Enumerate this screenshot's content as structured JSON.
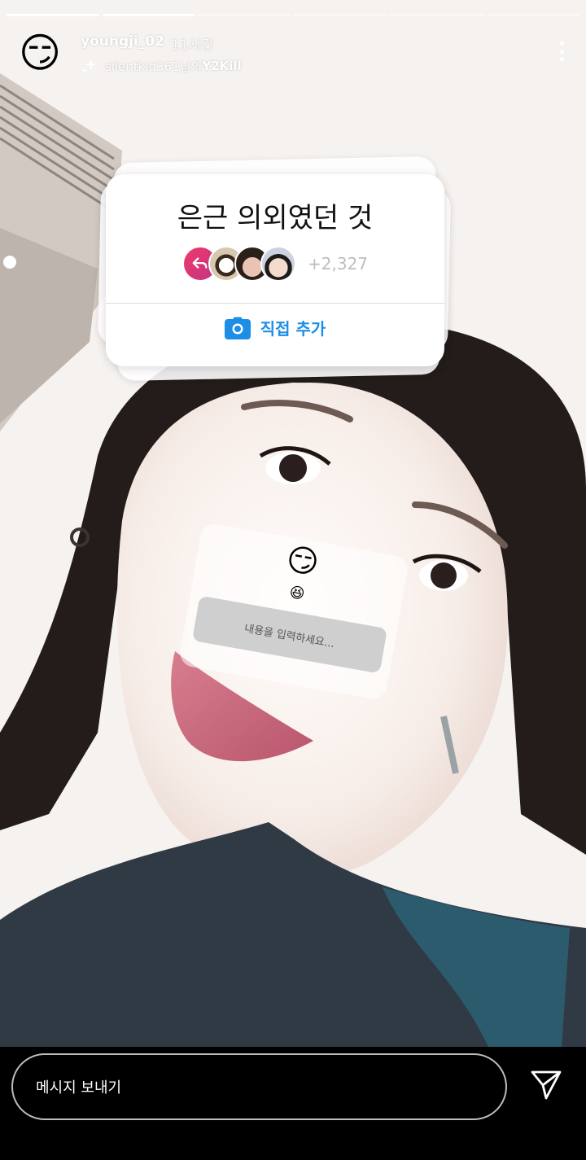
{
  "header": {
    "username": "youngji_02",
    "time": "11시간",
    "music_owner": "silentkid361님의",
    "music_song": "Y2Kill",
    "avatar_emoji": "😏"
  },
  "progress": [
    1.0,
    1.0,
    0.0,
    0.0,
    0.0,
    0.0
  ],
  "add_yours": {
    "title": "은근 의외였던 것",
    "count": "+2,327",
    "add_label": "직접 추가"
  },
  "question_sticker": {
    "emoji": "😏",
    "small_emoji": "😆",
    "placeholder": "내용을 입력하세요..."
  },
  "bottom_bar": {
    "message_placeholder": "메시지 보내기"
  },
  "colors": {
    "accent_blue": "#1d8ee6",
    "background": "#000000"
  }
}
